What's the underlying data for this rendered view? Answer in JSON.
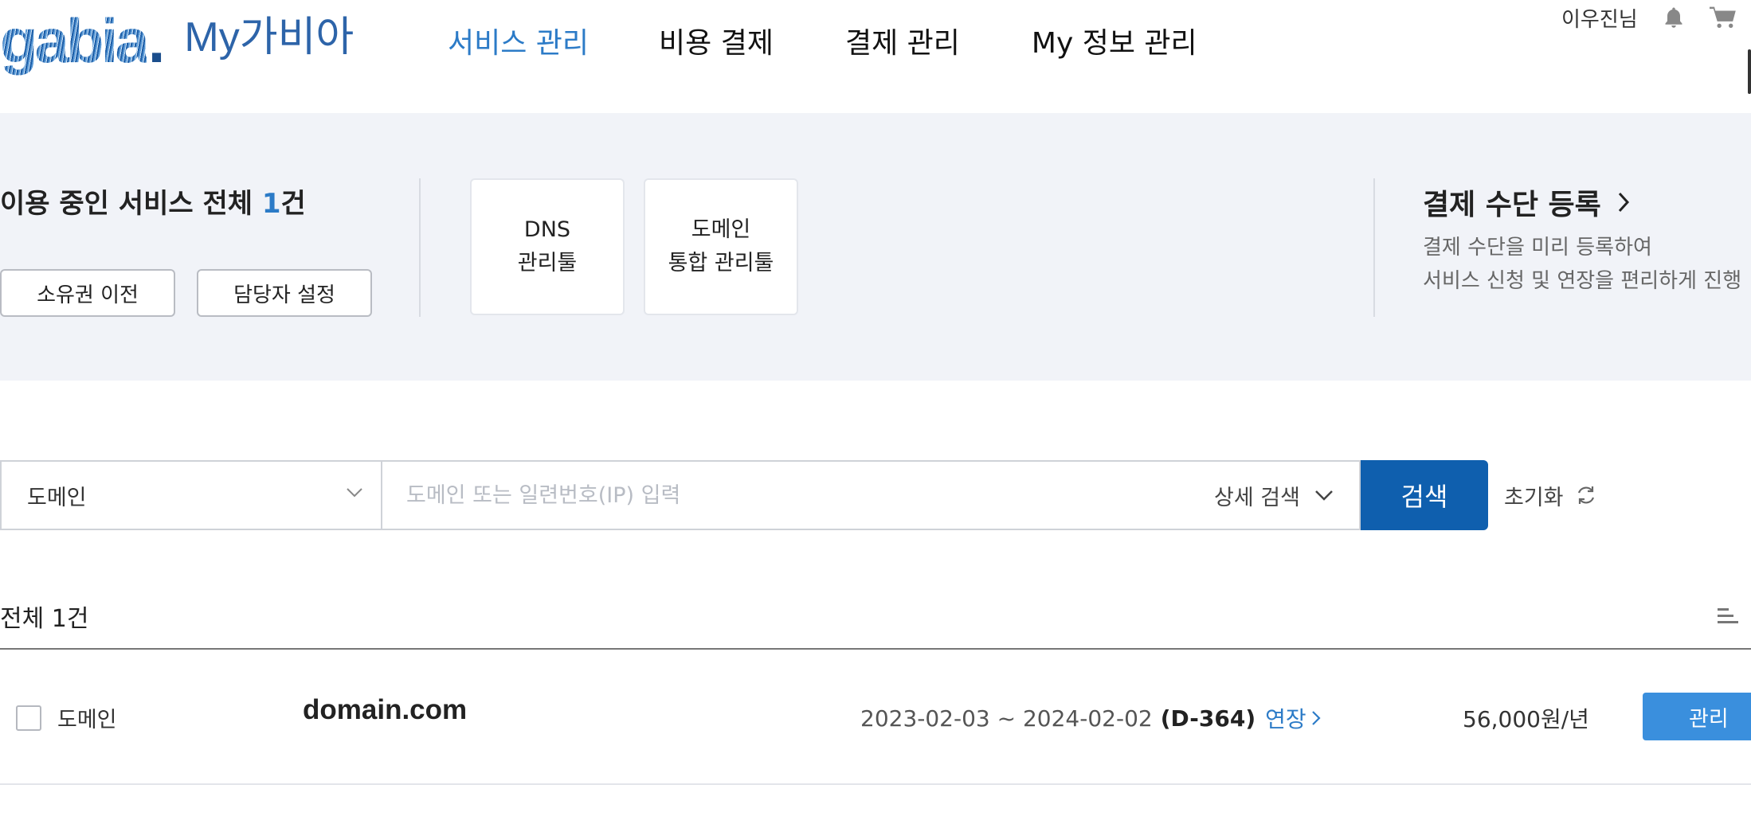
{
  "header": {
    "logo_text": "gabia",
    "logo_dot": ".",
    "logo_my": "My가비아",
    "nav": [
      {
        "label": "서비스 관리",
        "active": true
      },
      {
        "label": "비용 결제",
        "active": false
      },
      {
        "label": "결제 관리",
        "active": false
      },
      {
        "label": "My 정보 관리",
        "active": false
      }
    ],
    "user_name": "이우진님",
    "icons": [
      "bell-icon",
      "cart-icon"
    ]
  },
  "summary": {
    "title_prefix": "이용 중인 서비스 전체 ",
    "count": "1",
    "title_suffix": "건",
    "buttons": {
      "transfer": "소유권 이전",
      "contact": "담당자 설정"
    },
    "tools": {
      "dns_line1": "DNS",
      "dns_line2": "관리툴",
      "domain_line1": "도메인",
      "domain_line2": "통합 관리툴"
    },
    "payment": {
      "title": "결제 수단 등록",
      "desc_line1": "결제 수단을 미리 등록하여",
      "desc_line2": "서비스 신청 및 연장을 편리하게 진행"
    }
  },
  "search": {
    "category": "도메인",
    "placeholder": "도메인 또는 일련번호(IP) 입력",
    "detail_label": "상세 검색",
    "button_label": "검색",
    "reset_label": "초기화"
  },
  "list": {
    "count_label": "전체 1건",
    "rows": [
      {
        "type": "도메인",
        "domain": "domain.com",
        "period": "2023-02-03 ~ 2024-02-02",
        "dday": "(D-364)",
        "renew": "연장",
        "price": "56,000원/년",
        "manage": "관리"
      }
    ]
  },
  "colors": {
    "accent": "#2c7bc7",
    "search_button": "#0f5fae",
    "manage_button": "#3a8fdd",
    "band_bg": "#f1f3f8"
  }
}
